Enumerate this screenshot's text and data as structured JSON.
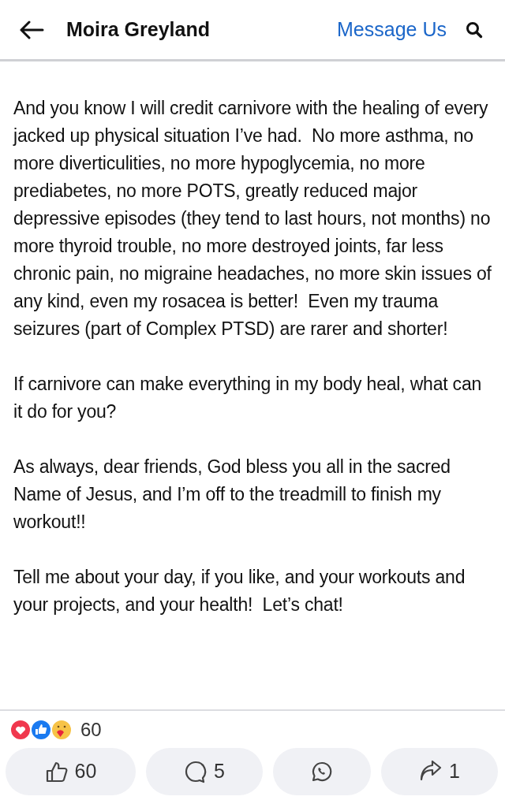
{
  "header": {
    "title": "Moira Greyland",
    "action": "Message Us"
  },
  "post": {
    "paragraphs": [
      "And you know I will credit carnivore with the healing of every jacked up physical situation I’ve had.  No more asthma, no more diverticulities, no more hypoglycemia, no more prediabetes, no more POTS, greatly reduced major depressive episodes (they tend to last hours, not months) no more thyroid trouble, no more destroyed joints, far less chronic pain, no migraine headaches, no more skin issues of any kind, even my rosacea is better!  Even my trauma seizures (part of Complex PTSD) are rarer and shorter!",
      "If carnivore can make everything in my body heal, what can it do for you?",
      "As always, dear friends, God bless you all in the sacred Name of Jesus, and I’m off to the treadmill to finish my workout!!",
      "Tell me about your day, if you like, and your workouts and your projects, and your health!  Let’s chat!"
    ]
  },
  "reactions": {
    "count": "60"
  },
  "actions": [
    {
      "kind": "like",
      "count": "60"
    },
    {
      "kind": "comment",
      "count": "5"
    },
    {
      "kind": "whatsapp"
    },
    {
      "kind": "share",
      "count": "1"
    }
  ]
}
